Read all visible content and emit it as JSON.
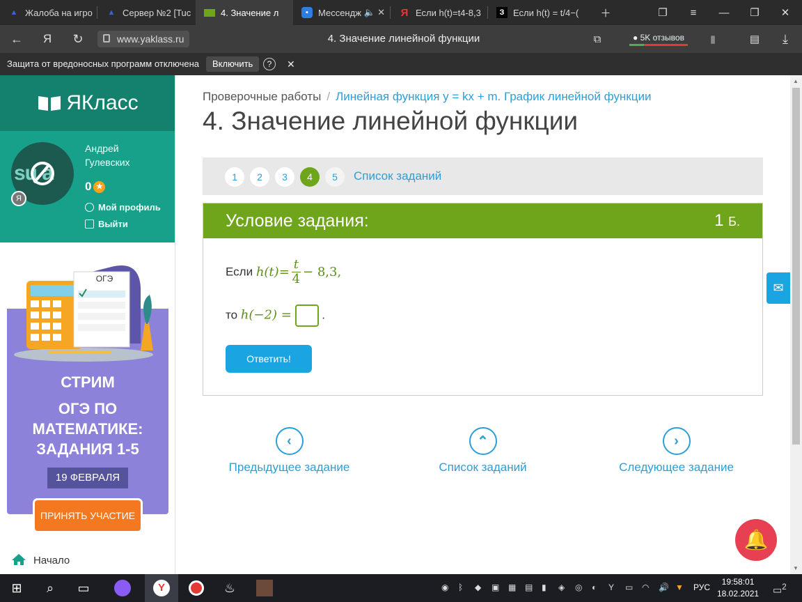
{
  "browser": {
    "tabs": [
      {
        "label": "Жалоба на игро",
        "fav_color": "#3a63d6"
      },
      {
        "label": "Сервер №2 [Tuc",
        "fav_color": "#3a63d6"
      },
      {
        "label": "4. Значение л",
        "fav_color": "#6ea51a"
      },
      {
        "label": "Мессендж",
        "fav_color": "#2e7de1"
      },
      {
        "label": "Если h(t)=t4-8,3",
        "fav_color": "#e53935"
      },
      {
        "label": "Если h(t) = t/4−(",
        "fav_color": "#000000"
      }
    ],
    "url": "www.yaklass.ru",
    "page_title": "4. Значение линейной функции",
    "reviews": "5K отзывов",
    "protection_msg": "Защита от вредоносных программ отключена",
    "protection_btn": "Включить"
  },
  "sidebar": {
    "logo": "ЯКласс",
    "user_first": "Андрей",
    "user_last": "Гулевских",
    "points": "0",
    "my_profile": "Мой профиль",
    "logout": "Выйти",
    "promo": {
      "sheet_label": "ОГЭ",
      "line1": "СТРИМ",
      "line2": "ОГЭ ПО",
      "line3": "МАТЕМАТИКЕ:",
      "line4": "ЗАДАНИЯ 1-5",
      "date": "19 ФЕВРАЛЯ",
      "button": "ПРИНЯТЬ УЧАСТИЕ"
    },
    "home": "Начало"
  },
  "main": {
    "breadcrumb_root": "Проверочные работы",
    "breadcrumb_link": "Линейная функция y = kx + m. График линейной функции",
    "title": "4. Значение линейной функции",
    "steps": [
      "1",
      "2",
      "3",
      "4",
      "5"
    ],
    "current_step": "4",
    "task_list_link": "Список заданий",
    "card_title": "Условие задания:",
    "card_points": "1",
    "card_points_unit": "Б.",
    "if_word": "Если",
    "then_word": "то",
    "h_of_t": "h(t)",
    "eq": "=",
    "frac_num": "t",
    "frac_den": "4",
    "minus_const": "− 8,3,",
    "h_of_neg2": "h(−2)",
    "period": ".",
    "answer_value": "",
    "submit": "Ответить!",
    "prev": "Предыдущее задание",
    "list": "Список заданий",
    "next": "Следующее задание"
  },
  "taskbar": {
    "lang": "РУС",
    "time": "19:58:01",
    "date": "18.02.2021",
    "notif_count": "2"
  },
  "colors": {
    "brand_green": "#14806e",
    "task_green": "#6ea51a",
    "link_blue": "#2a9fd8",
    "button_blue": "#1aa5e2",
    "promo_purple": "#8d82d9",
    "promo_orange": "#f47820",
    "bell_red": "#e64052"
  }
}
